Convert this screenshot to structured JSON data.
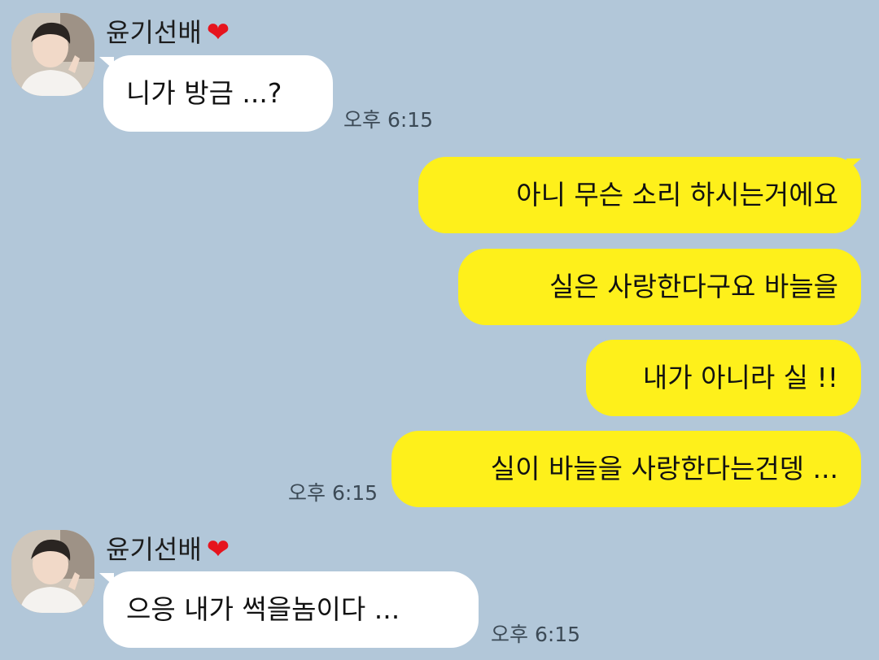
{
  "colors": {
    "background": "#b2c7d9",
    "incoming_bubble": "#ffffff",
    "outgoing_bubble": "#fef01b",
    "heart": "#e6141e"
  },
  "groups": [
    {
      "sender": "윤기선배",
      "heart": "❤",
      "avatar_icon": "profile-photo",
      "messages": [
        "니가 방금 ...?"
      ],
      "time": "오후 6:15"
    },
    {
      "messages": [
        "아니 무슨 소리 하시는거에요",
        "실은 사랑한다구요 바늘을",
        "내가 아니라 실 !!",
        "실이 바늘을 사랑한다는건뎅 ..."
      ],
      "time": "오후 6:15"
    },
    {
      "sender": "윤기선배",
      "heart": "❤",
      "avatar_icon": "profile-photo",
      "messages": [
        "으응 내가 썩을놈이다 ..."
      ],
      "time": "오후 6:15"
    }
  ]
}
